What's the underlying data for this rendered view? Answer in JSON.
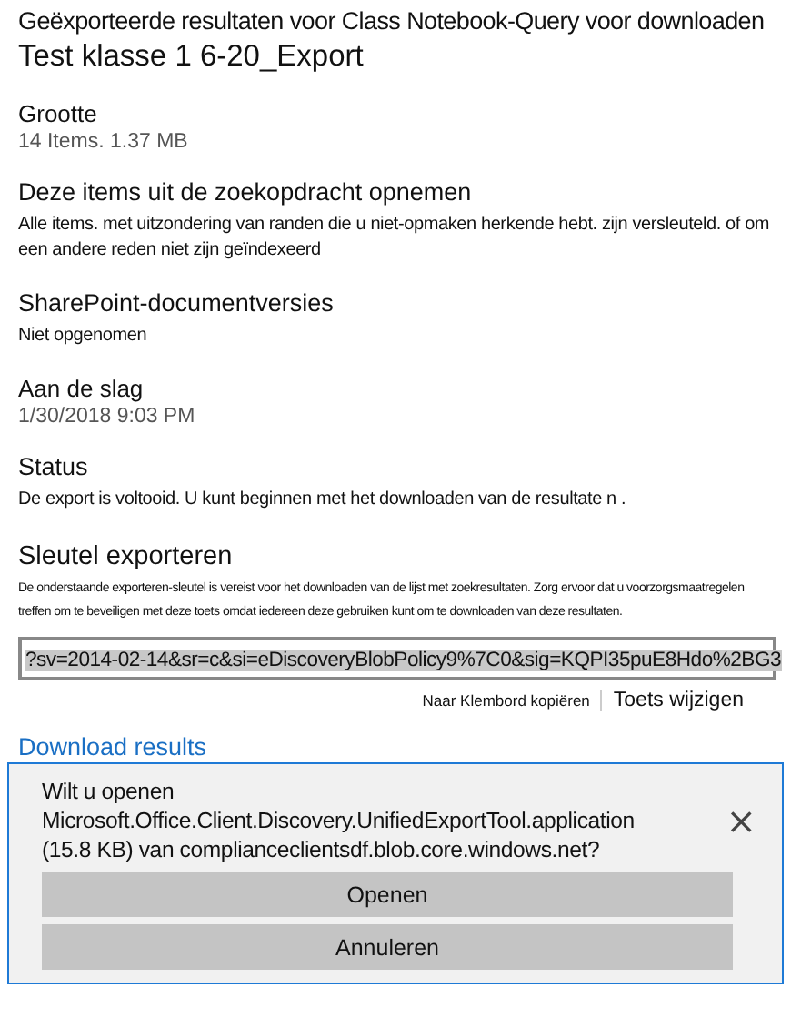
{
  "header": {
    "subtitle": "Geëxporteerde resultaten voor Class Notebook-Query voor downloaden",
    "title": "Test klasse 1 6-20_Export"
  },
  "sections": [
    {
      "heading": "Grootte",
      "text": "14 Items. 1.37 MB",
      "kind": "value"
    },
    {
      "heading": "Deze items uit de zoekopdracht opnemen",
      "text": "Alle items. met uitzondering van randen die u niet-opmaken herkende hebt. zijn versleuteld. of om een andere reden niet zijn geïndexeerd",
      "kind": "note"
    },
    {
      "heading": "SharePoint-documentversies",
      "text": "Niet opgenomen",
      "kind": "note"
    },
    {
      "heading": "Aan de slag",
      "text": "1/30/2018 9:03 PM",
      "kind": "value"
    },
    {
      "heading": "Status",
      "text": "De export is voltooid. U kunt beginnen met het downloaden van de resultate n .",
      "kind": "note"
    }
  ],
  "export_key": {
    "heading": "Sleutel exporteren",
    "description": "De onderstaande exporteren-sleutel is vereist voor het downloaden van de lijst met zoekresultaten. Zorg ervoor dat u voorzorgsmaatregelen treffen om te beveiligen met deze toets omdat iedereen deze gebruiken kunt om te downloaden van deze resultaten.",
    "value": "?sv=2014-02-14&sr=c&si=eDiscoveryBlobPolicy9%7C0&sig=KQPI35puE8Hdo%2BG3",
    "copy_link": "Naar Klembord kopiëren",
    "change_link": "Toets wijzigen"
  },
  "download_link": "Download results",
  "dialog": {
    "question": "Wilt u openen",
    "file": "Microsoft.Office.Client.Discovery.UnifiedExportTool.application",
    "source": "(15.8  KB) van complianceclientsdf.blob.core.windows.net?",
    "close": "×",
    "buttons": [
      "Openen",
      "Annuleren"
    ]
  }
}
